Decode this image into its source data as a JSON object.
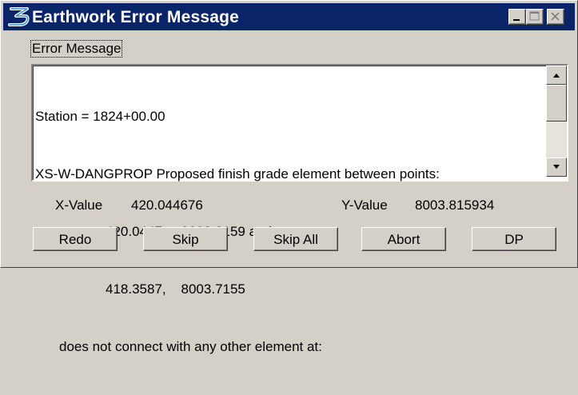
{
  "window": {
    "title": "Earthwork Error Message",
    "icon": "bentley-b-icon",
    "controls": [
      "minimize-icon",
      "maximize-icon",
      "close-icon"
    ]
  },
  "group": {
    "label": "Error Message"
  },
  "message": {
    "lines": [
      "Station = 1824+00.00",
      "XS-W-DANGPROP Proposed finish grade element between points:",
      "420.0447,    8003.8159 and",
      "418.3587,    8003.7155",
      "does not connect with any other element at:"
    ]
  },
  "values": {
    "x_label": "X-Value",
    "x_value": "420.044676",
    "y_label": "Y-Value",
    "y_value": "8003.815934"
  },
  "buttons": {
    "redo": "Redo",
    "skip": "Skip",
    "skip_all": "Skip All",
    "abort": "Abort",
    "dp": "DP"
  },
  "colors": {
    "titlebar": "#0a246a",
    "face": "#d4d0c8",
    "text_area": "#ffffff",
    "title_text": "#ffffff"
  }
}
